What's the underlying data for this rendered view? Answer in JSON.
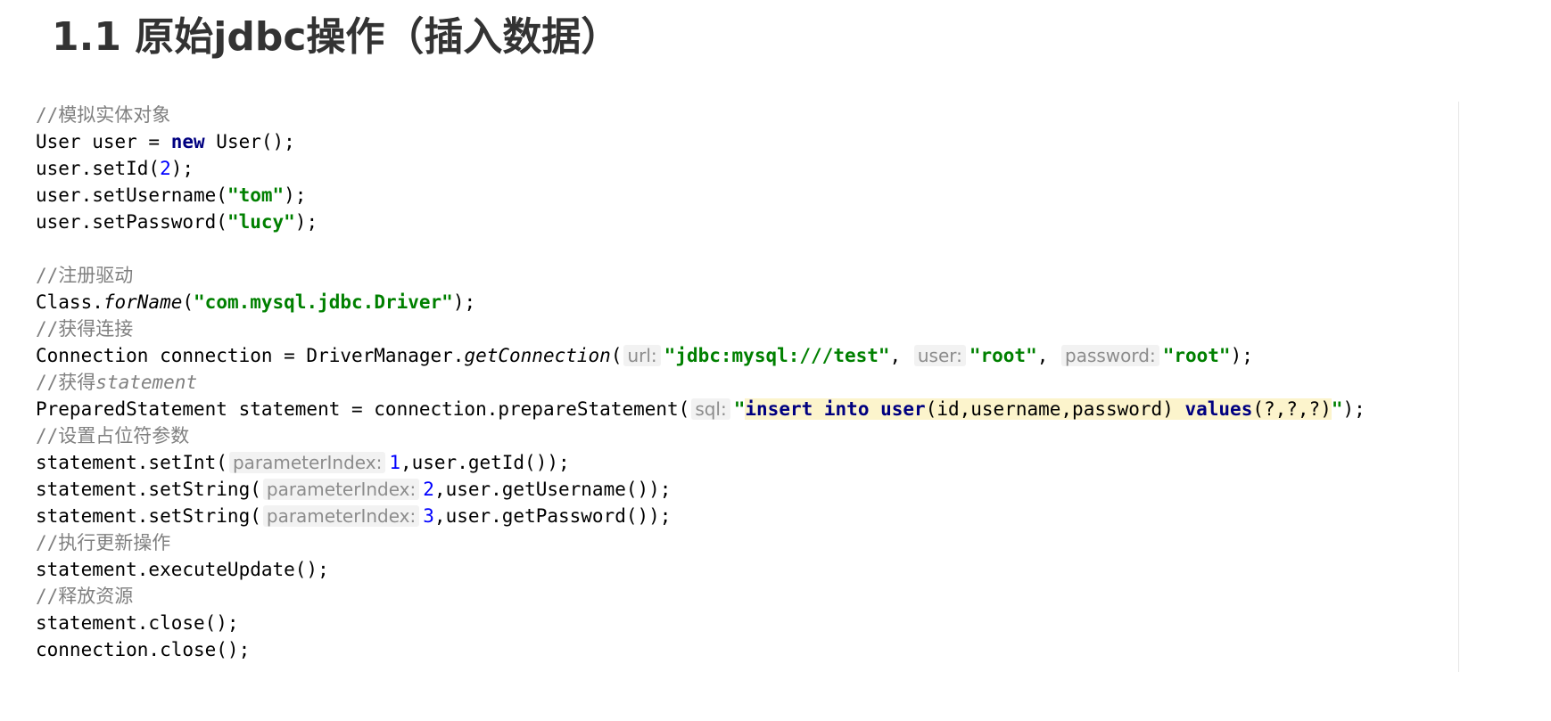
{
  "heading": "1.1 原始jdbc操作（插入数据）",
  "code": {
    "c1": "//模拟实体对象",
    "l2a": "User user = ",
    "l2kw": "new",
    "l2b": " User();",
    "l3a": "user.setId(",
    "l3num": "2",
    "l3b": ");",
    "l4a": "user.setUsername(",
    "l4str": "\"tom\"",
    "l4b": ");",
    "l5a": "user.setPassword(",
    "l5str": "\"lucy\"",
    "l5b": ");",
    "c7": "//注册驱动",
    "l8a": "Class.",
    "l8method": "forName",
    "l8b": "(",
    "l8str": "\"com.mysql.jdbc.Driver\"",
    "l8c": ");",
    "c9": "//获得连接",
    "l10a": "Connection connection = DriverManager.",
    "l10method": "getConnection",
    "l10b": "(",
    "l10hint1": "url:",
    "l10str1": "\"jdbc:mysql:///test\"",
    "l10comma1": ", ",
    "l10hint2": "user:",
    "l10str2": "\"root\"",
    "l10comma2": ", ",
    "l10hint3": "password:",
    "l10str3": "\"root\"",
    "l10c": ");",
    "c11a": "//获得",
    "c11b": "statement",
    "l12a": "PreparedStatement statement = connection.prepareStatement(",
    "l12hint": "sql:",
    "l12q1": "\"",
    "l12kw1": "insert into user",
    "l12plain1": "(id,username,password) ",
    "l12kw2": "values",
    "l12plain2": "(?,?,?)",
    "l12q2": "\"",
    "l12c": ");",
    "c13": "//设置占位符参数",
    "l14a": "statement.setInt(",
    "l14hint": "parameterIndex:",
    "l14num": "1",
    "l14b": ",user.getId());",
    "l15a": "statement.setString(",
    "l15hint": "parameterIndex:",
    "l15num": "2",
    "l15b": ",user.getUsername());",
    "l16a": "statement.setString(",
    "l16hint": "parameterIndex:",
    "l16num": "3",
    "l16b": ",user.getPassword());",
    "c17": "//执行更新操作",
    "l18": "statement.executeUpdate();",
    "c19": "//释放资源",
    "l20": "statement.close();",
    "l21": "connection.close();"
  }
}
